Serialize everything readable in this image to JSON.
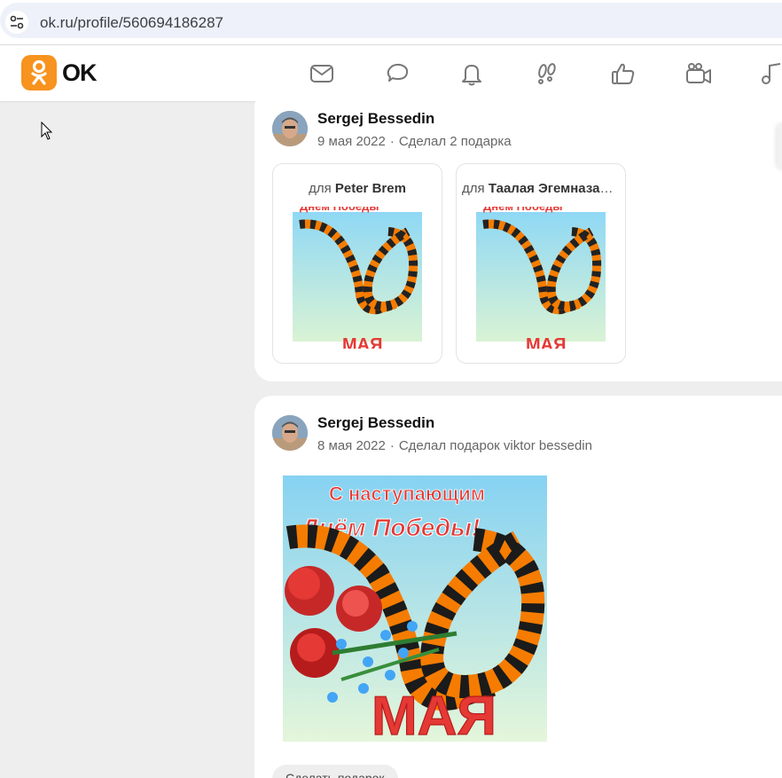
{
  "browser": {
    "url": "ok.ru/profile/560694186287"
  },
  "header": {
    "logo_text": "OK",
    "brand_color": "#f7931e",
    "nav_icons": [
      "envelope-icon",
      "chat-bubbles-icon",
      "bell-icon",
      "footprints-icon",
      "thumbs-up-icon",
      "video-camera-icon",
      "music-note-icon"
    ]
  },
  "posts": [
    {
      "author": "Sergej Bessedin",
      "date": "9 мая 2022",
      "action": "Сделал 2 подарка",
      "gifts": [
        {
          "prefix": "для",
          "recipient": "Peter Brem"
        },
        {
          "prefix": "для",
          "recipient": "Таалая Эгемназарова"
        }
      ]
    },
    {
      "author": "Sergej Bessedin",
      "date": "8 мая 2022",
      "action": "Сделал подарок viktor bessedin",
      "card_text_top": "С наступающим",
      "card_text_mid": "Днём Победы!",
      "card_text_bottom": "МАЯ",
      "button_label": "Сделать подарок"
    }
  ],
  "separator": "·"
}
